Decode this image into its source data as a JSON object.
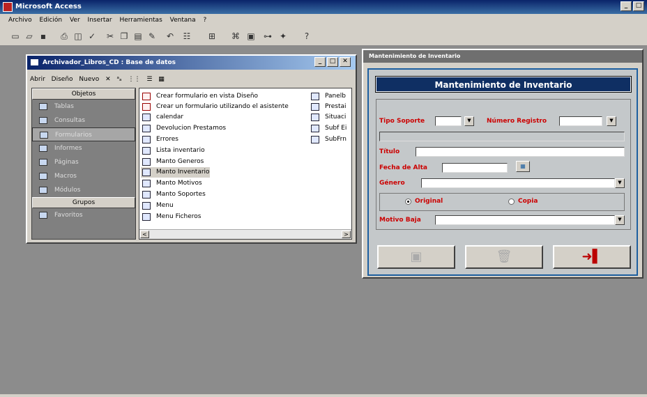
{
  "app": {
    "title": "Microsoft Access"
  },
  "menu": [
    "Archivo",
    "Edición",
    "Ver",
    "Insertar",
    "Herramientas",
    "Ventana",
    "?"
  ],
  "db_window": {
    "title": "Archivador_Libros_CD : Base de datos",
    "toolbar": {
      "open": "Abrir",
      "design": "Diseño",
      "new": "Nuevo"
    },
    "objects_header": "Objetos",
    "objects": [
      "Tablas",
      "Consultas",
      "Formularios",
      "Informes",
      "Páginas",
      "Macros",
      "Módulos"
    ],
    "groups_header": "Grupos",
    "groups": [
      "Favoritos"
    ],
    "list_col1": [
      "Crear formulario en vista Diseño",
      "Crear un formulario utilizando el asistente",
      "calendar",
      "Devolucion Prestamos",
      "Errores",
      "Lista inventario",
      "Manto Generos",
      "Manto Inventario",
      "Manto Motivos",
      "Manto Soportes",
      "Menu",
      "Menu Ficheros"
    ],
    "list_col2": [
      "Panelb",
      "Prestai",
      "Situaci",
      "Subf Ei",
      "SubFrn"
    ]
  },
  "form_window": {
    "title": "Mantenimiento de Inventario",
    "banner": "Mantenimiento de Inventario",
    "fields": {
      "tipo_soporte": "Tipo Soporte",
      "numero_registro": "Número Registro",
      "titulo": "Título",
      "fecha_alta": "Fecha de Alta",
      "genero": "Género",
      "motivo_baja": "Motivo Baja"
    },
    "radio": {
      "original": "Original",
      "copia": "Copia",
      "selected": "original"
    }
  }
}
